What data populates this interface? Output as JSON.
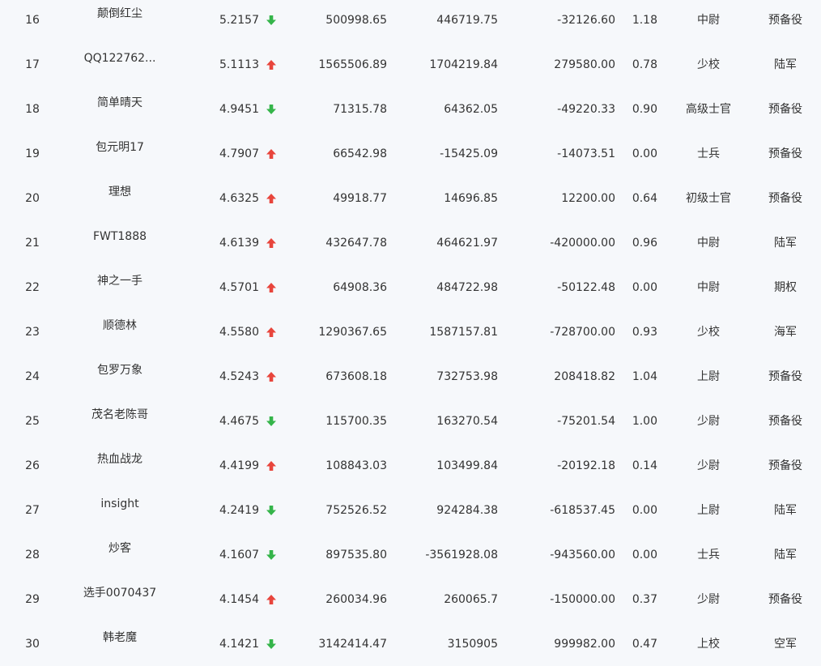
{
  "colors": {
    "up": "#e8453c",
    "down": "#35b54a"
  },
  "rows": [
    {
      "rank": "16",
      "name": "颠倒红尘",
      "score": "5.2157",
      "trend": "down",
      "v1": "500998.65",
      "v2": "446719.75",
      "v3": "-32126.60",
      "ratio": "1.18",
      "rank_title": "中尉",
      "branch": "预备役"
    },
    {
      "rank": "17",
      "name": "QQ122762...",
      "score": "5.1113",
      "trend": "up",
      "v1": "1565506.89",
      "v2": "1704219.84",
      "v3": "279580.00",
      "ratio": "0.78",
      "rank_title": "少校",
      "branch": "陆军"
    },
    {
      "rank": "18",
      "name": "简单晴天",
      "score": "4.9451",
      "trend": "down",
      "v1": "71315.78",
      "v2": "64362.05",
      "v3": "-49220.33",
      "ratio": "0.90",
      "rank_title": "高级士官",
      "branch": "预备役"
    },
    {
      "rank": "19",
      "name": "包元明17",
      "score": "4.7907",
      "trend": "up",
      "v1": "66542.98",
      "v2": "-15425.09",
      "v3": "-14073.51",
      "ratio": "0.00",
      "rank_title": "士兵",
      "branch": "预备役"
    },
    {
      "rank": "20",
      "name": "理想",
      "score": "4.6325",
      "trend": "up",
      "v1": "49918.77",
      "v2": "14696.85",
      "v3": "12200.00",
      "ratio": "0.64",
      "rank_title": "初级士官",
      "branch": "预备役"
    },
    {
      "rank": "21",
      "name": "FWT1888",
      "score": "4.6139",
      "trend": "up",
      "v1": "432647.78",
      "v2": "464621.97",
      "v3": "-420000.00",
      "ratio": "0.96",
      "rank_title": "中尉",
      "branch": "陆军"
    },
    {
      "rank": "22",
      "name": "神之一手",
      "score": "4.5701",
      "trend": "up",
      "v1": "64908.36",
      "v2": "484722.98",
      "v3": "-50122.48",
      "ratio": "0.00",
      "rank_title": "中尉",
      "branch": "期权"
    },
    {
      "rank": "23",
      "name": "顺德林",
      "score": "4.5580",
      "trend": "up",
      "v1": "1290367.65",
      "v2": "1587157.81",
      "v3": "-728700.00",
      "ratio": "0.93",
      "rank_title": "少校",
      "branch": "海军"
    },
    {
      "rank": "24",
      "name": "包罗万象",
      "score": "4.5243",
      "trend": "up",
      "v1": "673608.18",
      "v2": "732753.98",
      "v3": "208418.82",
      "ratio": "1.04",
      "rank_title": "上尉",
      "branch": "预备役"
    },
    {
      "rank": "25",
      "name": "茂名老陈哥",
      "score": "4.4675",
      "trend": "down",
      "v1": "115700.35",
      "v2": "163270.54",
      "v3": "-75201.54",
      "ratio": "1.00",
      "rank_title": "少尉",
      "branch": "预备役"
    },
    {
      "rank": "26",
      "name": "热血战龙",
      "score": "4.4199",
      "trend": "up",
      "v1": "108843.03",
      "v2": "103499.84",
      "v3": "-20192.18",
      "ratio": "0.14",
      "rank_title": "少尉",
      "branch": "预备役"
    },
    {
      "rank": "27",
      "name": "insight",
      "score": "4.2419",
      "trend": "down",
      "v1": "752526.52",
      "v2": "924284.38",
      "v3": "-618537.45",
      "ratio": "0.00",
      "rank_title": "上尉",
      "branch": "陆军"
    },
    {
      "rank": "28",
      "name": "炒客",
      "score": "4.1607",
      "trend": "down",
      "v1": "897535.80",
      "v2": "-3561928.08",
      "v3": "-943560.00",
      "ratio": "0.00",
      "rank_title": "士兵",
      "branch": "陆军"
    },
    {
      "rank": "29",
      "name": "选手0070437",
      "score": "4.1454",
      "trend": "up",
      "v1": "260034.96",
      "v2": "260065.7",
      "v3": "-150000.00",
      "ratio": "0.37",
      "rank_title": "少尉",
      "branch": "预备役"
    },
    {
      "rank": "30",
      "name": "韩老魔",
      "score": "4.1421",
      "trend": "down",
      "v1": "3142414.47",
      "v2": "3150905",
      "v3": "999982.00",
      "ratio": "0.47",
      "rank_title": "上校",
      "branch": "空军"
    }
  ]
}
